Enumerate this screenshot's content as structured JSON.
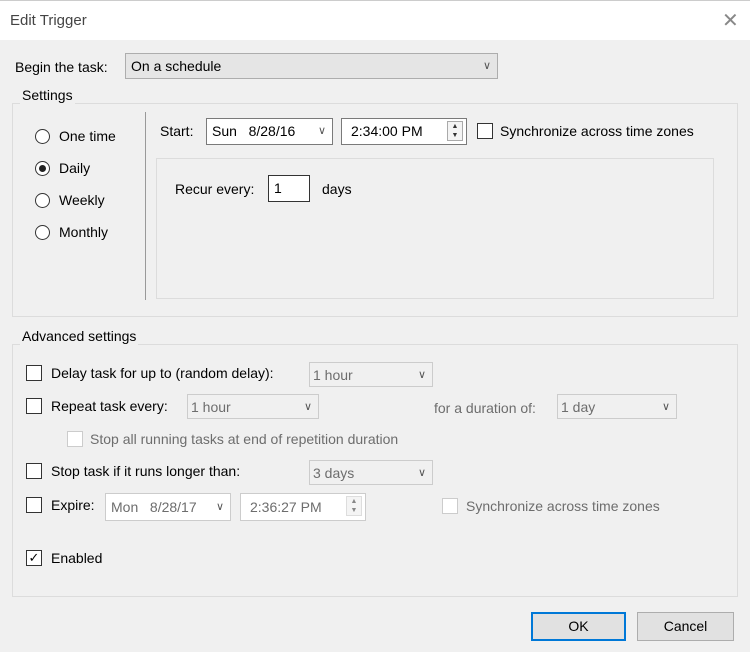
{
  "window": {
    "title": "Edit Trigger",
    "close_icon": "close-icon"
  },
  "begin": {
    "label": "Begin the task:",
    "value": "On a schedule"
  },
  "settings": {
    "label": "Settings",
    "radios": [
      {
        "label": "One time",
        "selected": false
      },
      {
        "label": "Daily",
        "selected": true
      },
      {
        "label": "Weekly",
        "selected": false
      },
      {
        "label": "Monthly",
        "selected": false
      }
    ],
    "start_label": "Start:",
    "start_day": "Sun",
    "start_date": "8/28/16",
    "start_time": "2:34:00 PM",
    "sync_label": "Synchronize across time zones",
    "sync_checked": false,
    "recur_label": "Recur every:",
    "recur_value": "1",
    "recur_unit": "days"
  },
  "advanced": {
    "label": "Advanced settings",
    "delay_label": "Delay task for up to (random delay):",
    "delay_value": "1 hour",
    "repeat_label": "Repeat task every:",
    "repeat_value": "1 hour",
    "duration_label": "for a duration of:",
    "duration_value": "1 day",
    "stop_all_label": "Stop all running tasks at end of repetition duration",
    "stop_label": "Stop task if it runs longer than:",
    "stop_value": "3 days",
    "expire_label": "Expire:",
    "expire_day": "Mon",
    "expire_date": "8/28/17",
    "expire_time": "2:36:27 PM",
    "expire_sync_label": "Synchronize across time zones",
    "enabled_label": "Enabled",
    "enabled_checked": true
  },
  "buttons": {
    "ok": "OK",
    "cancel": "Cancel"
  },
  "colors": {
    "accent": "#0078d7"
  }
}
